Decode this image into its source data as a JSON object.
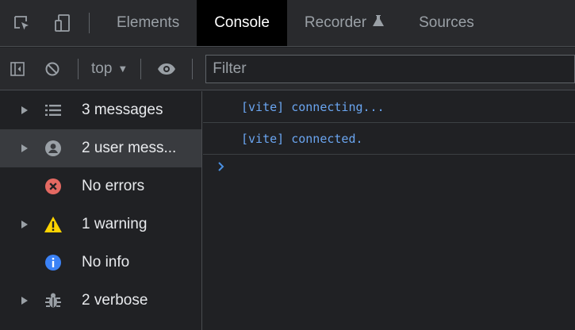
{
  "tabs": {
    "items": [
      "Elements",
      "Console",
      "Recorder",
      "Sources"
    ],
    "active": "Console",
    "recorder_icon": "flask-icon"
  },
  "toolbar": {
    "context": "top",
    "filter_placeholder": "Filter"
  },
  "sidebar": {
    "items": [
      {
        "label": "3 messages",
        "icon": "list-icon"
      },
      {
        "label": "2 user mess...",
        "icon": "user-icon"
      },
      {
        "label": "No errors",
        "icon": "error-icon"
      },
      {
        "label": "1 warning",
        "icon": "warning-icon"
      },
      {
        "label": "No info",
        "icon": "info-icon"
      },
      {
        "label": "2 verbose",
        "icon": "bug-icon"
      }
    ],
    "selected_index": 1
  },
  "console": {
    "messages": [
      "[vite] connecting...",
      "[vite] connected."
    ]
  },
  "colors": {
    "message_text": "#6aa5f0",
    "error": "#e46962",
    "warning": "#fdd300",
    "info": "#3b82f6"
  }
}
